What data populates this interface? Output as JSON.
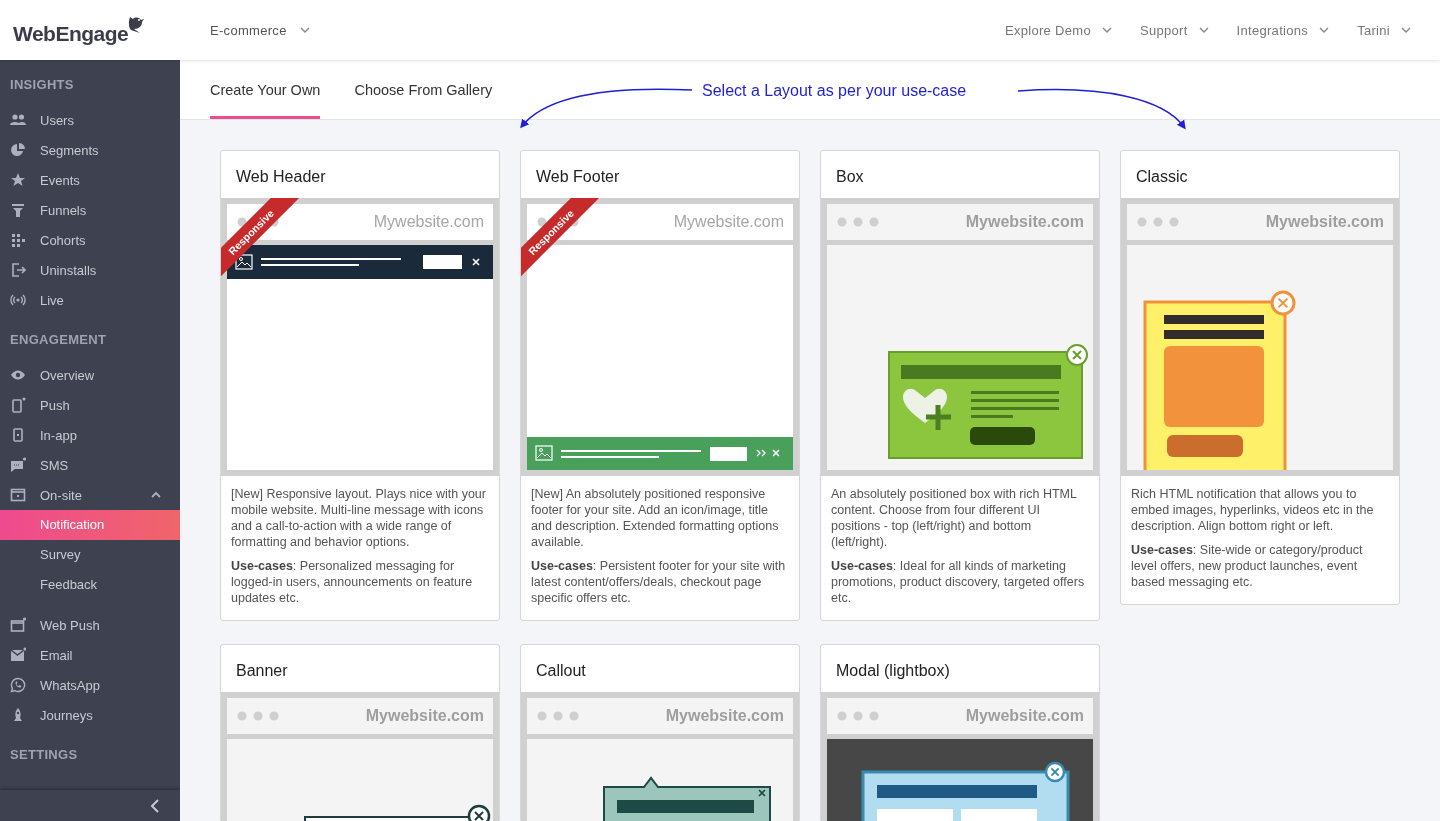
{
  "top_bar": {
    "logo": "WebEngage",
    "project": "E-commerce",
    "menu": [
      {
        "label": "Explore Demo"
      },
      {
        "label": "Support"
      },
      {
        "label": "Integrations"
      },
      {
        "label": "Tarini"
      }
    ]
  },
  "sidebar": {
    "sections": [
      {
        "title": "INSIGHTS",
        "items": [
          {
            "label": "Users",
            "selected": false
          },
          {
            "label": "Segments",
            "selected": false
          },
          {
            "label": "Events",
            "selected": false
          },
          {
            "label": "Funnels",
            "selected": false
          },
          {
            "label": "Cohorts",
            "selected": false
          },
          {
            "label": "Uninstalls",
            "selected": false
          },
          {
            "label": "Live",
            "selected": false
          }
        ]
      },
      {
        "title": "ENGAGEMENT",
        "items": [
          {
            "label": "Overview",
            "selected": false
          },
          {
            "label": "Push",
            "selected": false
          },
          {
            "label": "In-app",
            "selected": false
          },
          {
            "label": "SMS",
            "selected": false
          },
          {
            "label": "On-site",
            "selected": false,
            "expanded": true,
            "children": [
              {
                "label": "Notification",
                "selected": true
              },
              {
                "label": "Survey",
                "selected": false
              },
              {
                "label": "Feedback",
                "selected": false
              }
            ]
          },
          {
            "label": "Web Push",
            "selected": false
          },
          {
            "label": "Email",
            "selected": false
          },
          {
            "label": "WhatsApp",
            "selected": false
          },
          {
            "label": "Journeys",
            "selected": false
          }
        ]
      },
      {
        "title": "SETTINGS"
      }
    ]
  },
  "tabs": [
    {
      "label": "Create Your Own",
      "selected": true
    },
    {
      "label": "Choose From Gallery",
      "selected": false
    }
  ],
  "annotation": {
    "text": "Select a Layout as per your use-case"
  },
  "cards": [
    {
      "title": "Web Header",
      "kind": "web-header",
      "badge": "Responsive",
      "url": "Mywebsite.com",
      "description": "[New] Responsive layout. Plays nice with your mobile website. Multi-line message with icons and a call-to-action with a wide range of formatting and behavior options.",
      "use_cases": "**Use-cases**: Personalized messaging for logged-in users, announcements on feature updates etc."
    },
    {
      "title": "Web Footer",
      "kind": "web-footer",
      "badge": "Responsive",
      "url": "Mywebsite.com",
      "description": "[New] An absolutely positioned responsive footer for your site. Add an icon/image, title and description. Extended formatting options available.",
      "use_cases": "**Use-cases**: Persistent footer for your site with latest content/offers/deals, checkout page specific offers etc."
    },
    {
      "title": "Box",
      "kind": "box",
      "url": "Mywebsite.com",
      "description": "An absolutely positioned box with rich HTML content. Choose from four different UI positions - top (left/right) and bottom (left/right).",
      "use_cases": "**Use-cases**: Ideal for all kinds of marketing promotions, product discovery, targeted offers etc."
    },
    {
      "title": "Classic",
      "kind": "classic",
      "url": "Mywebsite.com",
      "description": "Rich HTML notification that allows you to embed images, hyperlinks, videos etc in the description. Align bottom right or left.",
      "use_cases": "**Use-cases**: Site-wide or category/product level offers, new product launches, event based messaging etc."
    },
    {
      "title": "Banner",
      "kind": "banner",
      "url": "Mywebsite.com"
    },
    {
      "title": "Callout",
      "kind": "callout",
      "url": "Mywebsite.com"
    },
    {
      "title": "Modal (lightbox)",
      "kind": "modal",
      "url": "Mywebsite.com"
    }
  ]
}
